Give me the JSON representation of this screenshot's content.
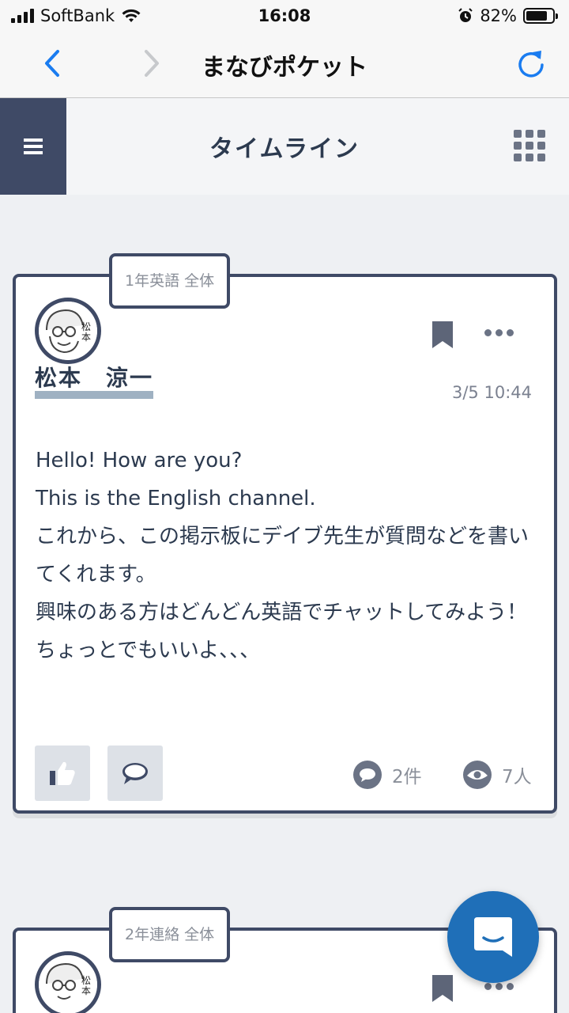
{
  "status_bar": {
    "carrier": "SoftBank",
    "time": "16:08",
    "battery": "82%",
    "battery_level": 0.82
  },
  "browser": {
    "title": "まなびポケット"
  },
  "app_header": {
    "title": "タイムライン"
  },
  "posts": [
    {
      "channel": "1年英語 全体",
      "avatar_text": "松本",
      "author": "松本　涼一",
      "time": "3/5 10:44",
      "body_lines": [
        "Hello! How are you?",
        "This is the English channel.",
        "これから、この掲示板にデイブ先生が質問などを書いてくれます。",
        "興味のある方はどんどん英語でチャットしてみよう！",
        "ちょっとでもいいよ、、、"
      ],
      "comment_count": "2件",
      "view_count": "7人"
    },
    {
      "channel": "2年連絡 全体",
      "avatar_text": "松本"
    }
  ],
  "colors": {
    "accent": "#1f6fb8",
    "nav_blue": "#1a7cf0",
    "card_border": "#3f4a66",
    "underline": "#9fb1c2"
  }
}
